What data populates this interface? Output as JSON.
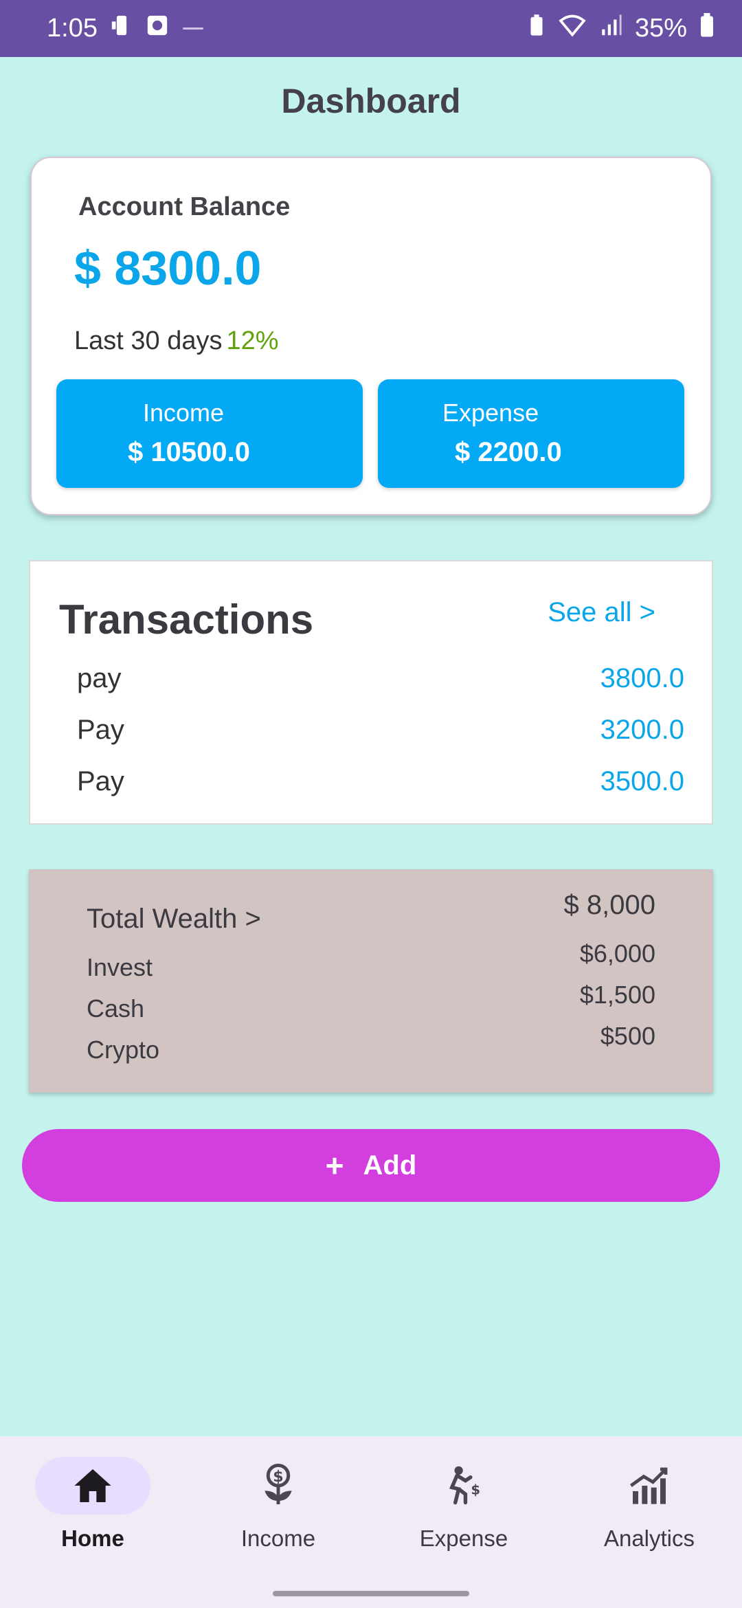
{
  "status_bar": {
    "time": "1:05",
    "battery": "35%"
  },
  "page": {
    "title": "Dashboard"
  },
  "balance": {
    "label": "Account Balance",
    "amount": "$ 8300.0",
    "period_label": "Last 30 days",
    "change": "12%",
    "income_label": "Income",
    "income_value": "$ 10500.0",
    "expense_label": "Expense",
    "expense_value": "$ 2200.0"
  },
  "transactions": {
    "title": "Transactions",
    "see_all": "See all >",
    "items": [
      {
        "name": "pay",
        "amount": "3800.0"
      },
      {
        "name": "Pay",
        "amount": "3200.0"
      },
      {
        "name": "Pay",
        "amount": "3500.0"
      }
    ]
  },
  "wealth": {
    "title": "Total Wealth >",
    "total": "$ 8,000",
    "items": [
      {
        "label": "Invest",
        "value": "$6,000"
      },
      {
        "label": "Cash",
        "value": "$1,500"
      },
      {
        "label": "Crypto",
        "value": "$500"
      }
    ]
  },
  "add_button": {
    "label": "Add"
  },
  "nav": {
    "items": [
      {
        "label": "Home",
        "icon": "home-icon"
      },
      {
        "label": "Income",
        "icon": "income-icon"
      },
      {
        "label": "Expense",
        "icon": "expense-icon"
      },
      {
        "label": "Analytics",
        "icon": "analytics-icon"
      }
    ]
  },
  "colors": {
    "background": "#c4f3ee",
    "status_bar": "#6750a4",
    "accent_blue": "#03a9f4",
    "positive": "#62a20c",
    "add_button": "#d33ede",
    "wealth_card": "#d3c4c4"
  }
}
